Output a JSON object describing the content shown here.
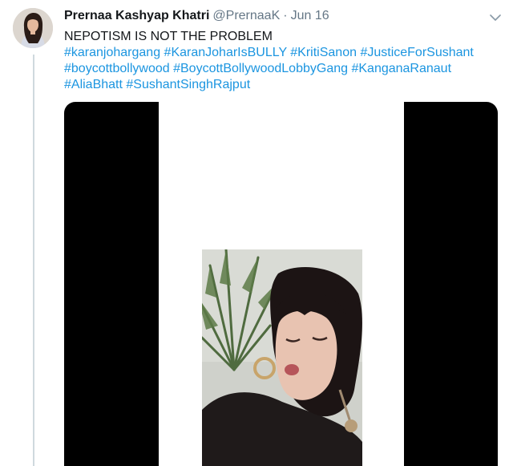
{
  "tweet": {
    "display_name": "Prernaa Kashyap Khatri",
    "handle": "@PrernaaK",
    "separator": "·",
    "date": "Jun 16",
    "text_lines": [
      {
        "plain": "NEPOTISM IS NOT THE PROBLEM"
      },
      {
        "hashtags": [
          "#karanjohargang",
          "#KaranJoharIsBULLY",
          "#KritiSanon",
          "#JusticeForSushant"
        ]
      },
      {
        "hashtags": [
          "#boycottbollywood",
          "#BoycottBollywoodLobbyGang",
          "#KanganaRanaut"
        ]
      },
      {
        "hashtags": [
          "#AliaBhatt",
          "#SushantSinghRajput"
        ]
      }
    ]
  },
  "icons": {
    "avatar": "user-avatar-photo",
    "menu": "chevron-down-icon",
    "media": "video-frame-woman-speaking"
  },
  "colors": {
    "hashtag": "#1b95e0",
    "name": "#14171a",
    "secondary": "#657786",
    "thread_line": "#cfd9de"
  }
}
